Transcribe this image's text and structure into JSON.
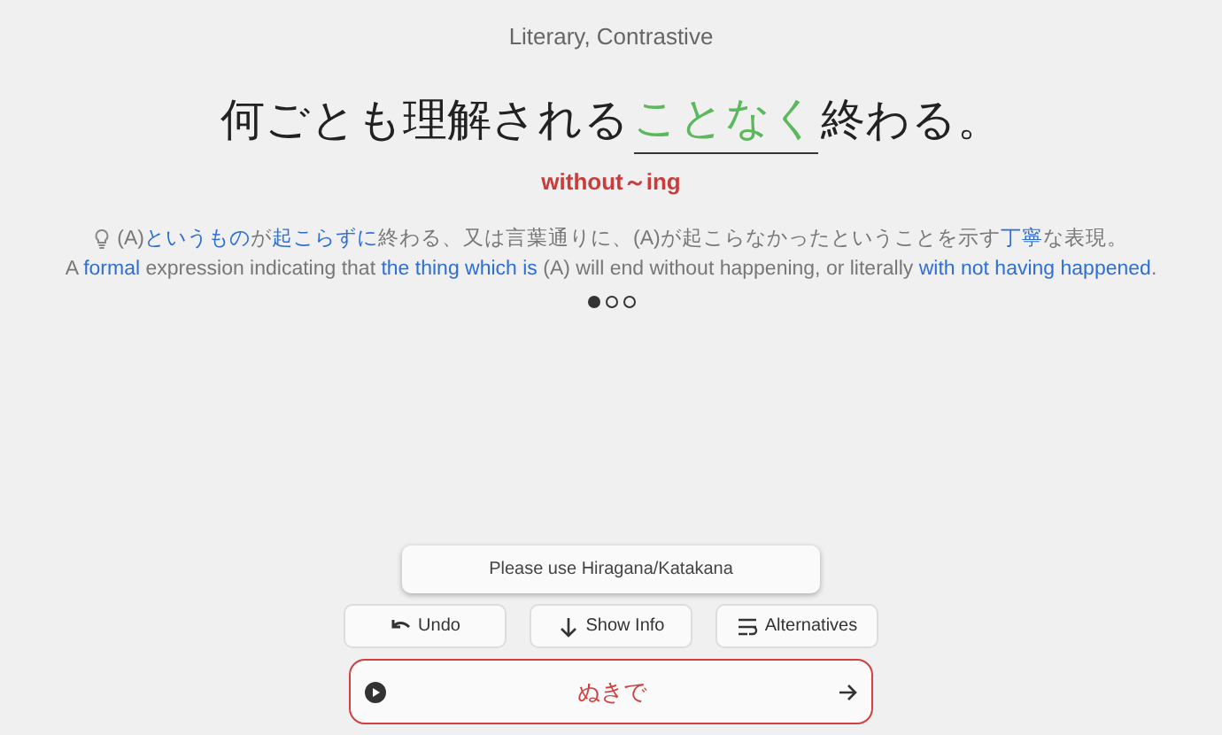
{
  "header": {
    "tags": "Literary, Contrastive"
  },
  "sentence": {
    "before": "何ごとも理解される",
    "answer": "ことなく",
    "after": "終わる。"
  },
  "meaning": "without～ing",
  "hint_jp": [
    {
      "text": "(A)",
      "highlight": false
    },
    {
      "text": "というもの",
      "highlight": true
    },
    {
      "text": "が",
      "highlight": false
    },
    {
      "text": "起こらずに",
      "highlight": true
    },
    {
      "text": "終わる、又は言葉通りに、(A)が起こらなかったということを示す",
      "highlight": false
    },
    {
      "text": "丁寧",
      "highlight": true
    },
    {
      "text": "な表現。",
      "highlight": false
    }
  ],
  "hint_en": [
    {
      "text": "A ",
      "highlight": false
    },
    {
      "text": "formal",
      "highlight": true
    },
    {
      "text": " expression indicating that ",
      "highlight": false
    },
    {
      "text": "the thing which is",
      "highlight": true
    },
    {
      "text": " (A) will end without happening, or literally ",
      "highlight": false
    },
    {
      "text": "with not having happened",
      "highlight": true
    },
    {
      "text": ".",
      "highlight": false
    }
  ],
  "pager": [
    {
      "selected": true
    },
    {
      "selected": false
    },
    {
      "selected": false
    }
  ],
  "notice": "Please use Hiragana/Katakana",
  "buttons": [
    {
      "kind": "undo",
      "label": "Undo"
    },
    {
      "kind": "info",
      "label": "Show Info"
    },
    {
      "kind": "alternatives",
      "label": "Alternatives"
    }
  ],
  "answer_field": {
    "value": "ぬきで",
    "correct": false
  }
}
